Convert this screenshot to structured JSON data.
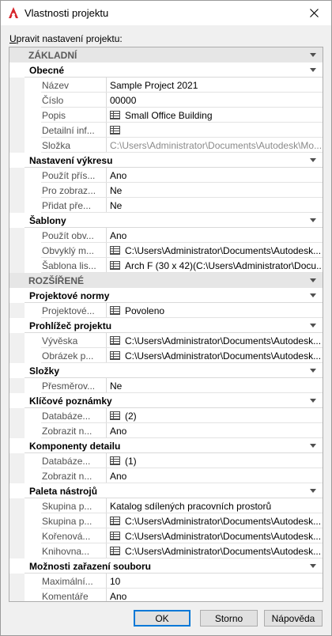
{
  "window": {
    "title": "Vlastnosti projektu",
    "subtitle_first": "U",
    "subtitle_rest": "pravit nastavení projektu:"
  },
  "grid": {
    "rows": [
      {
        "kind": "cat",
        "label": "ZÁKLADNÍ"
      },
      {
        "kind": "sub",
        "label": "Obecné"
      },
      {
        "kind": "prop",
        "name": "Název",
        "value": "Sample Project 2021"
      },
      {
        "kind": "prop",
        "name": "Číslo",
        "value": "00000"
      },
      {
        "kind": "prop",
        "name": "Popis",
        "value": "Small Office Building",
        "icon": true
      },
      {
        "kind": "prop",
        "name": "Detailní inf...",
        "value": "",
        "icon": true
      },
      {
        "kind": "prop",
        "name": "Složka",
        "value": "C:\\Users\\Administrator\\Documents\\Autodesk\\Mo...",
        "disabled": true
      },
      {
        "kind": "sub",
        "label": "Nastavení výkresu"
      },
      {
        "kind": "prop",
        "name": "Použít přís...",
        "value": "Ano"
      },
      {
        "kind": "prop",
        "name": "Pro zobraz...",
        "value": "Ne"
      },
      {
        "kind": "prop",
        "name": "Přidat pře...",
        "value": "Ne"
      },
      {
        "kind": "sub",
        "label": "Šablony"
      },
      {
        "kind": "prop",
        "name": "Použít obv...",
        "value": "Ano"
      },
      {
        "kind": "prop",
        "name": "Obvyklý m...",
        "value": "C:\\Users\\Administrator\\Documents\\Autodesk...",
        "icon": true
      },
      {
        "kind": "prop",
        "name": "Šablona lis...",
        "value": "Arch F (30 x 42)(C:\\Users\\Administrator\\Docu...",
        "icon": true
      },
      {
        "kind": "cat",
        "label": "ROZŠÍŘENÉ"
      },
      {
        "kind": "sub",
        "label": "Projektové normy"
      },
      {
        "kind": "prop",
        "name": "Projektové...",
        "value": "Povoleno",
        "icon": true
      },
      {
        "kind": "sub",
        "label": "Prohlížeč projektu"
      },
      {
        "kind": "prop",
        "name": "Vývěska",
        "value": "C:\\Users\\Administrator\\Documents\\Autodesk...",
        "icon": true
      },
      {
        "kind": "prop",
        "name": "Obrázek p...",
        "value": "C:\\Users\\Administrator\\Documents\\Autodesk...",
        "icon": true
      },
      {
        "kind": "sub",
        "label": "Složky"
      },
      {
        "kind": "prop",
        "name": "Přesměrov...",
        "value": "Ne"
      },
      {
        "kind": "sub",
        "label": "Klíčové poznámky"
      },
      {
        "kind": "prop",
        "name": "Databáze...",
        "value": "(2)",
        "icon": true
      },
      {
        "kind": "prop",
        "name": "Zobrazit n...",
        "value": "Ano"
      },
      {
        "kind": "sub",
        "label": "Komponenty detailu"
      },
      {
        "kind": "prop",
        "name": "Databáze...",
        "value": "(1)",
        "icon": true
      },
      {
        "kind": "prop",
        "name": "Zobrazit n...",
        "value": "Ano"
      },
      {
        "kind": "sub",
        "label": "Paleta nástrojů"
      },
      {
        "kind": "prop",
        "name": "Skupina p...",
        "value": "Katalog sdílených pracovních prostorů"
      },
      {
        "kind": "prop",
        "name": "Skupina p...",
        "value": "C:\\Users\\Administrator\\Documents\\Autodesk...",
        "icon": true
      },
      {
        "kind": "prop",
        "name": "Kořenová...",
        "value": "C:\\Users\\Administrator\\Documents\\Autodesk...",
        "icon": true
      },
      {
        "kind": "prop",
        "name": "Knihovna...",
        "value": "C:\\Users\\Administrator\\Documents\\Autodesk...",
        "icon": true
      },
      {
        "kind": "sub",
        "label": "Možnosti zařazení souboru"
      },
      {
        "kind": "prop",
        "name": "Maximální...",
        "value": "10"
      },
      {
        "kind": "prop",
        "name": "Komentáře",
        "value": "Ano"
      }
    ]
  },
  "buttons": {
    "ok": "OK",
    "cancel": "Storno",
    "help": "Nápověda"
  }
}
